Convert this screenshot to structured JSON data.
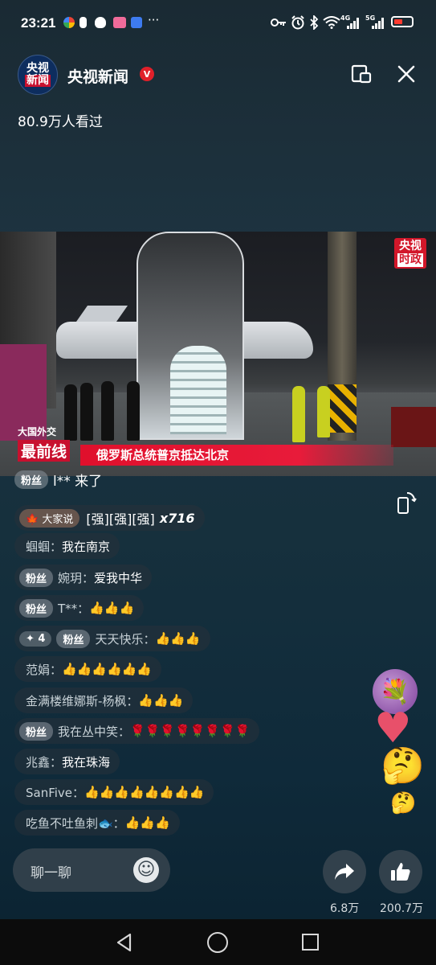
{
  "status_bar": {
    "time": "23:21",
    "network_4g": "4G",
    "network_5g": "5G",
    "icons": [
      "app-icon-1",
      "app-icon-2",
      "alert-icon",
      "qq-icon",
      "app-icon-3",
      "app-icon-4",
      "more-dots",
      "key-icon",
      "alarm-icon",
      "bluetooth-icon",
      "wifi-icon",
      "signal-icon",
      "signal-icon-2",
      "battery-icon"
    ],
    "more": "···"
  },
  "header": {
    "logo_line1": "央视",
    "logo_line2": "新闻",
    "channel_name": "央视新闻",
    "verified_mark": "V",
    "viewers": "80.9万人看过"
  },
  "video": {
    "corner_tag_line1": "央视",
    "corner_tag_line2": "时政",
    "program_line1": "大国外交",
    "program_line2": "最前线",
    "ticker": "俄罗斯总统普京抵达北京"
  },
  "chat": {
    "fans_join": {
      "badge": "粉丝",
      "text": "l** 来了"
    },
    "crowd": {
      "badge": "大家说",
      "emotes": "[强][强][强]",
      "count": "x716"
    },
    "messages": [
      {
        "badge": "",
        "name": "蝈蝈：",
        "text": "我在南京"
      },
      {
        "badge": "粉丝",
        "name": "婉玥：",
        "text": "爱我中华"
      },
      {
        "badge": "粉丝",
        "name": "T**：",
        "text": "👍👍👍"
      },
      {
        "badge": "粉丝",
        "level": "✦ 4",
        "name": "天天快乐：",
        "text": "👍👍👍"
      },
      {
        "badge": "",
        "name": "范娟：",
        "text": "👍👍👍👍👍👍"
      },
      {
        "badge": "",
        "name": "金满楼维娜斯-杨枫：",
        "text": "👍👍👍"
      },
      {
        "badge": "粉丝",
        "name": "我在丛中笑：",
        "text": "🌹🌹🌹🌹🌹🌹🌹🌹"
      },
      {
        "badge": "",
        "name": "兆鑫：",
        "text": "我在珠海"
      },
      {
        "badge": "",
        "name": "SanFive：",
        "text": "👍👍👍👍👍👍👍👍"
      },
      {
        "badge": "",
        "name": "吃鱼不吐鱼刺🐟：",
        "text": "👍👍👍"
      }
    ]
  },
  "bottom": {
    "input_placeholder": "聊一聊",
    "share_count": "6.8万",
    "like_count": "200.7万"
  }
}
